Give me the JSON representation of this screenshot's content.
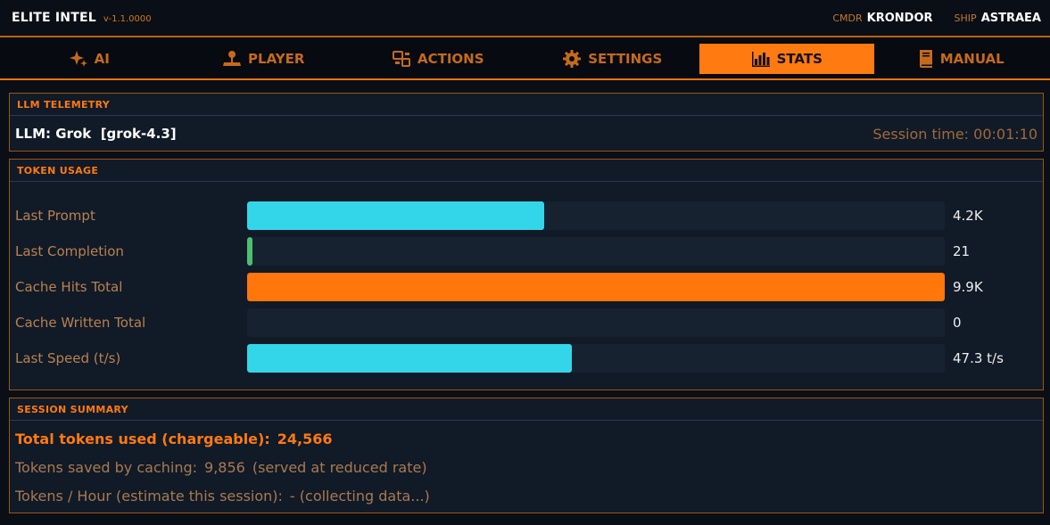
{
  "app": {
    "title": "ELITE INTEL",
    "version": "v-1.1.0000"
  },
  "header": {
    "cmdr_label": "CMDR",
    "cmdr_name": "KRONDOR",
    "ship_label": "SHIP",
    "ship_name": "ASTRAEA"
  },
  "tabs": [
    {
      "label": "AI",
      "icon": "sparkle-icon",
      "active": false
    },
    {
      "label": "PLAYER",
      "icon": "joystick-icon",
      "active": false
    },
    {
      "label": "ACTIONS",
      "icon": "actions-icon",
      "active": false
    },
    {
      "label": "SETTINGS",
      "icon": "gear-icon",
      "active": false
    },
    {
      "label": "STATS",
      "icon": "bar-chart-icon",
      "active": true
    },
    {
      "label": "MANUAL",
      "icon": "book-icon",
      "active": false
    }
  ],
  "telemetry": {
    "title": "LLM TELEMETRY",
    "llm": "LLM: Grok  [grok-4.3]",
    "session_time": "Session time: 00:01:10"
  },
  "tokens": {
    "title": "TOKEN USAGE",
    "rows": [
      {
        "label": "Last Prompt",
        "value": "4.2K",
        "fill": 0.426,
        "color": "#33d6e8"
      },
      {
        "label": "Last Completion",
        "value": "21",
        "fill": 0.008,
        "color": "#4cc070"
      },
      {
        "label": "Cache Hits Total",
        "value": "9.9K",
        "fill": 1.0,
        "color": "#ff760a"
      },
      {
        "label": "Cache Written Total",
        "value": "0",
        "fill": 0.0,
        "color": "#33d6e8"
      },
      {
        "label": "Last Speed (t/s)",
        "value": "47.3 t/s",
        "fill": 0.465,
        "color": "#33d6e8"
      }
    ]
  },
  "summary": {
    "title": "SESSION SUMMARY",
    "total_label": "Total tokens used (chargeable):",
    "total_value": "24,566",
    "saved_label": "Tokens saved by caching:",
    "saved_value": "9,856",
    "saved_note": "(served at reduced rate)",
    "hour_label": "Tokens / Hour (estimate this session):",
    "hour_value": "- (collecting data...)"
  }
}
